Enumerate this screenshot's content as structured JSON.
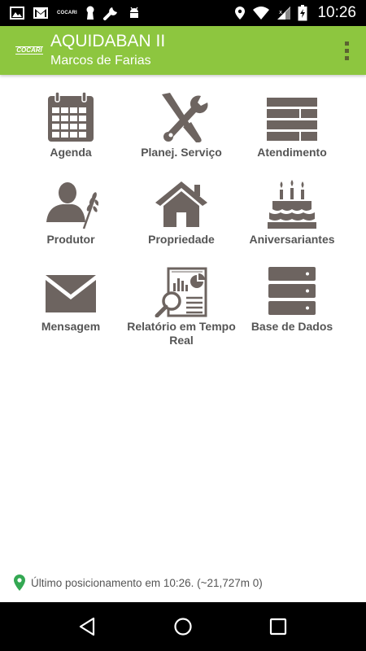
{
  "status_bar": {
    "time": "10:26",
    "mini_logo": "COCARI",
    "icons": [
      "image-icon",
      "gmail-icon",
      "cocari-icon",
      "keyhole-icon",
      "wrench-icon",
      "android-icon",
      "location-icon",
      "wifi-icon",
      "battery-icon"
    ]
  },
  "app_bar": {
    "logo_text": "COCARI",
    "title": "AQUIDABAN II",
    "subtitle": "Marcos de Farias",
    "overflow_icon": "overflow-menu-icon"
  },
  "menu": {
    "items": [
      {
        "label": "Agenda",
        "icon": "calendar-icon"
      },
      {
        "label": "Planej. Serviço",
        "icon": "tools-icon"
      },
      {
        "label": "Atendimento",
        "icon": "list-icon"
      },
      {
        "label": "Produtor",
        "icon": "farmer-icon"
      },
      {
        "label": "Propriedade",
        "icon": "house-icon"
      },
      {
        "label": "Aniversariantes",
        "icon": "cake-icon"
      },
      {
        "label": "Mensagem",
        "icon": "envelope-icon"
      },
      {
        "label": "Relatório em Tempo Real",
        "icon": "report-icon"
      },
      {
        "label": "Base de Dados",
        "icon": "database-icon"
      }
    ]
  },
  "location": {
    "text": "Último posicionamento em 10:26. (~21,727m 0)",
    "icon": "map-pin-icon"
  },
  "nav_bar": {
    "icons": [
      "back-icon",
      "home-icon",
      "recents-icon"
    ]
  },
  "colors": {
    "app_bar": "#8dc63f",
    "icon": "#6d6460",
    "label": "#555555",
    "pin": "#34a853"
  }
}
